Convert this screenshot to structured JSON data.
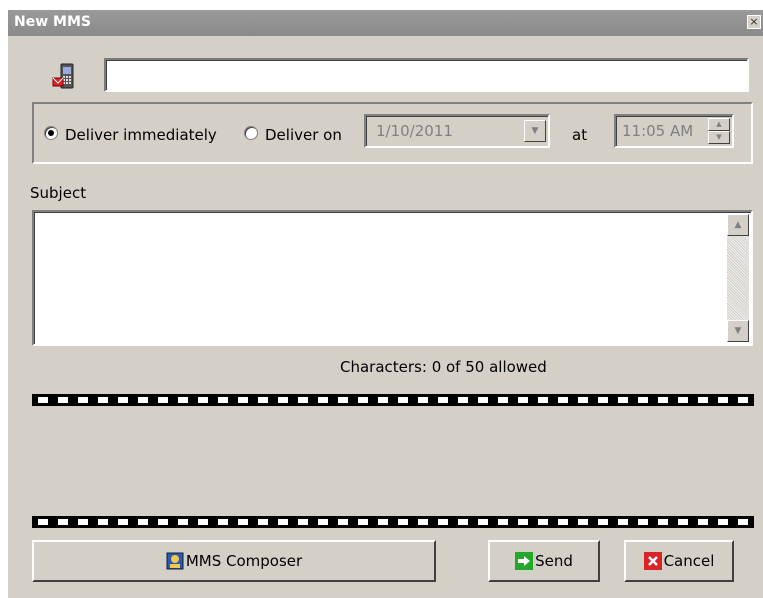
{
  "window": {
    "title": "New MMS",
    "close_glyph": "×"
  },
  "recipient": {
    "value": "",
    "icon": "mobile-phone-icon"
  },
  "delivery": {
    "immediately_label": "Deliver immediately",
    "on_label": "Deliver on",
    "selected": "immediately",
    "date_value": "1/10/2011",
    "at_label": "at",
    "time_value": "11:05 AM"
  },
  "subject": {
    "label": "Subject",
    "value": ""
  },
  "counter_text": "Characters: 0 of 50 allowed",
  "buttons": {
    "composer_label": "MMS Composer",
    "send_label": "Send",
    "cancel_label": "Cancel"
  },
  "colors": {
    "window_bg": "#d4d0c8",
    "titlebar": "#8a8a8a",
    "send_icon": "#22a82a",
    "cancel_icon": "#d9252a"
  }
}
